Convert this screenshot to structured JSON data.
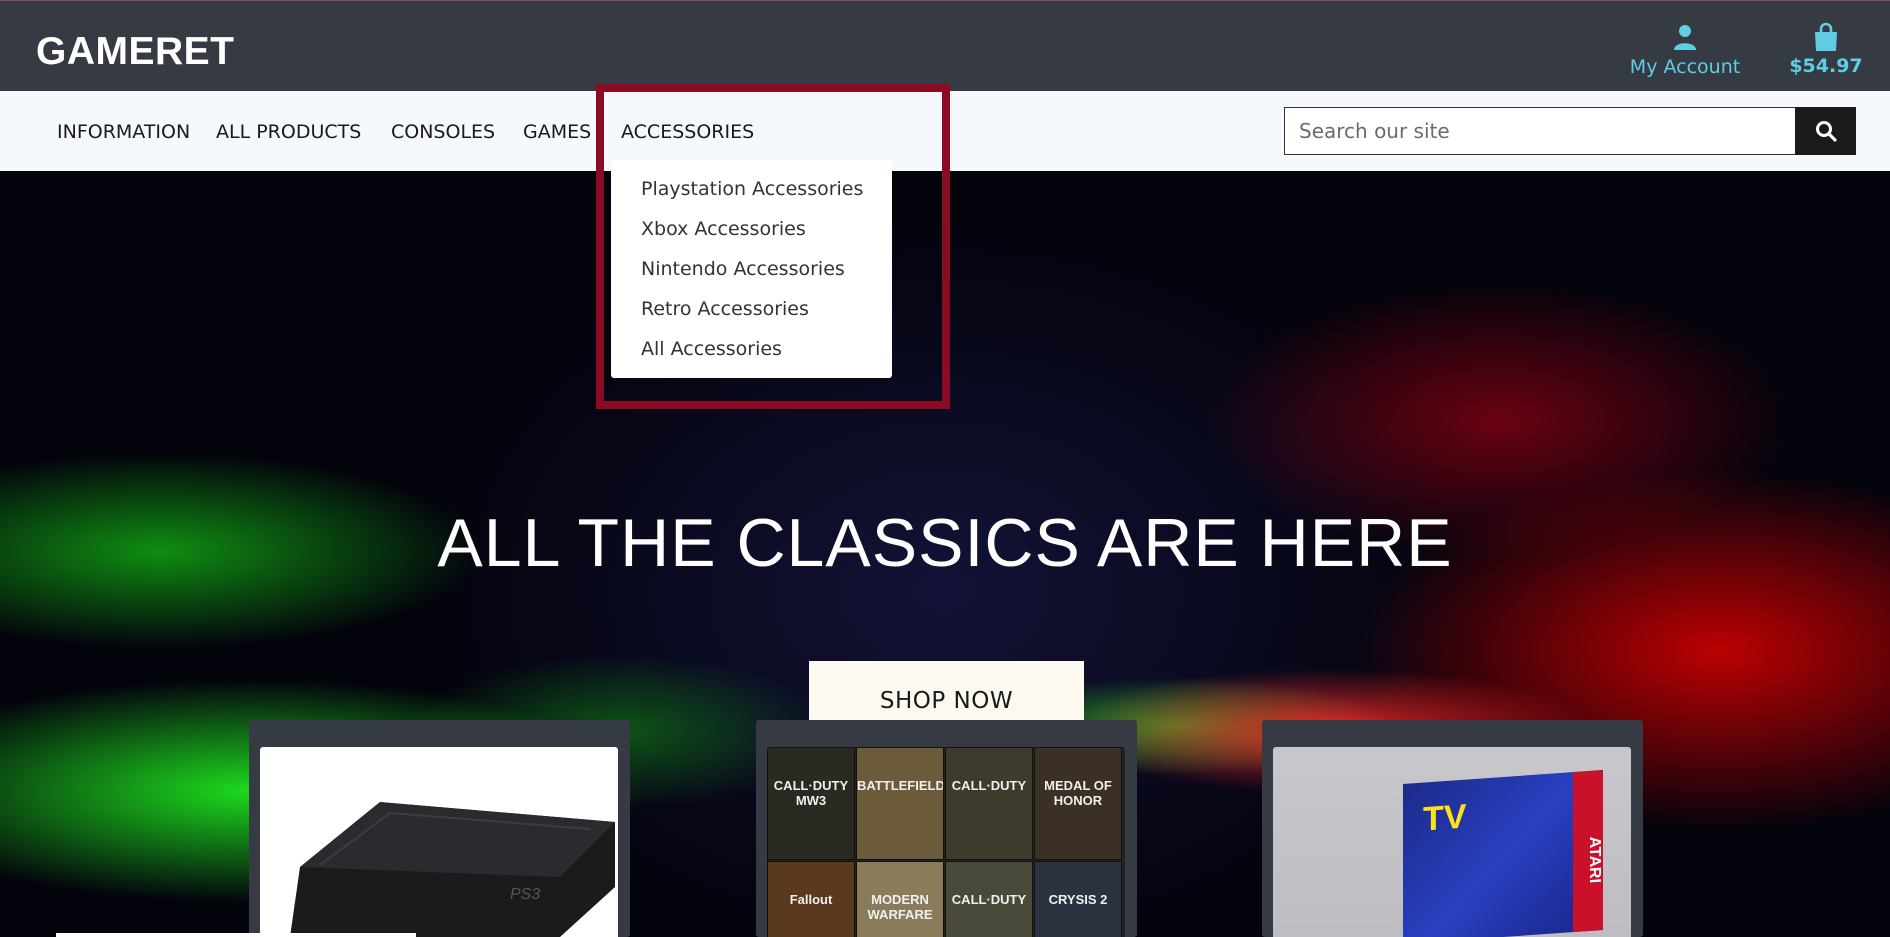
{
  "header": {
    "logo": "GAMERET",
    "account_label": "My Account",
    "cart_total": "$54.97",
    "account_icon": "user-icon",
    "cart_icon": "shopping-bag-icon",
    "accent_color": "#5fcde4"
  },
  "nav": {
    "items": [
      {
        "label": "INFORMATION"
      },
      {
        "label": "ALL PRODUCTS"
      },
      {
        "label": "CONSOLES"
      },
      {
        "label": "GAMES"
      },
      {
        "label": "ACCESSORIES"
      }
    ],
    "search_placeholder": "Search our site",
    "search_icon": "magnifier-icon"
  },
  "dropdown": {
    "parent": "ACCESSORIES",
    "items": [
      {
        "label": "Playstation Accessories"
      },
      {
        "label": "Xbox Accessories"
      },
      {
        "label": "Nintendo Accessories"
      },
      {
        "label": "Retro Accessories"
      },
      {
        "label": "All Accessories"
      }
    ],
    "highlight_color": "#8b0b24"
  },
  "hero": {
    "title": "ALL THE CLASSICS ARE HERE",
    "cta": "SHOP NOW"
  },
  "cards": {
    "console_image": "ps3-console-image",
    "games_image": "game-covers-collage",
    "covers": [
      {
        "label": "CALL·DUTY MW3"
      },
      {
        "label": "BATTLEFIELD"
      },
      {
        "label": "CALL·DUTY"
      },
      {
        "label": "MEDAL OF HONOR"
      },
      {
        "label": "Fallout"
      },
      {
        "label": "MODERN WARFARE"
      },
      {
        "label": "CALL·DUTY"
      },
      {
        "label": "CRYSIS 2"
      }
    ],
    "retro_image": "atari-tv-games-box",
    "retro_box_text": "TV",
    "retro_brand": "ATARI"
  }
}
